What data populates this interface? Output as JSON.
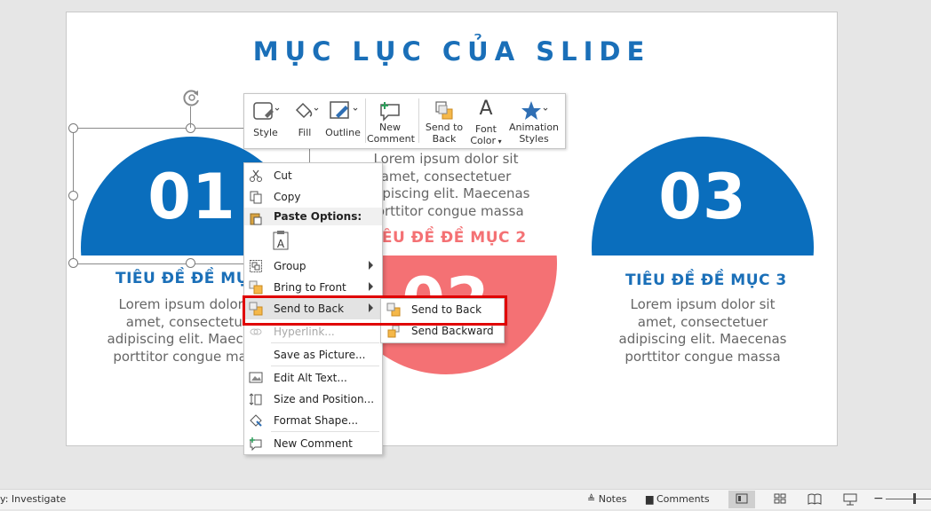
{
  "slide": {
    "title": "MỤC LỤC CỦA SLIDE",
    "items": [
      {
        "number": "01",
        "heading": "TIÊU ĐỀ ĐỀ MỤC 1",
        "body": "Lorem ipsum dolor sit\namet, consectetuer\nadipiscing elit. Maecenas\nporttitor congue massa",
        "color": "#0a6ebd"
      },
      {
        "number": "02",
        "heading": "TIÊU ĐỀ ĐỀ MỤC 2",
        "body": "Lorem ipsum dolor sit\namet, consectetuer\nadipiscing elit. Maecenas\nporttitor congue massa",
        "color": "#f47174"
      },
      {
        "number": "03",
        "heading": "TIÊU ĐỀ ĐỀ MỤC 3",
        "body": "Lorem ipsum dolor sit\namet, consectetuer\nadipiscing elit. Maecenas\nporttitor congue massa",
        "color": "#0a6ebd"
      }
    ]
  },
  "mini_toolbar": {
    "style": "Style",
    "fill": "Fill",
    "outline": "Outline",
    "new_comment_1": "New",
    "new_comment_2": "Comment",
    "send_to_back_1": "Send to",
    "send_to_back_2": "Back",
    "font_color_1": "Font",
    "font_color_2": "Color",
    "animation_styles_1": "Animation",
    "animation_styles_2": "Styles"
  },
  "context_menu": {
    "cut": "Cut",
    "copy": "Copy",
    "paste_options": "Paste Options:",
    "group": "Group",
    "bring_to_front": "Bring to Front",
    "send_to_back": "Send to Back",
    "hyperlink": "Hyperlink...",
    "save_as_picture": "Save as Picture...",
    "edit_alt_text": "Edit Alt Text...",
    "size_and_position": "Size and Position...",
    "format_shape": "Format Shape...",
    "new_comment": "New Comment"
  },
  "submenu": {
    "send_to_back": "Send to Back",
    "send_backward": "Send Backward"
  },
  "status_bar": {
    "left": "y: Investigate",
    "notes": "Notes",
    "comments": "Comments"
  },
  "colors": {
    "accent_blue": "#1a6fb8",
    "accent_coral": "#f47174",
    "highlight_red": "#e00000"
  }
}
